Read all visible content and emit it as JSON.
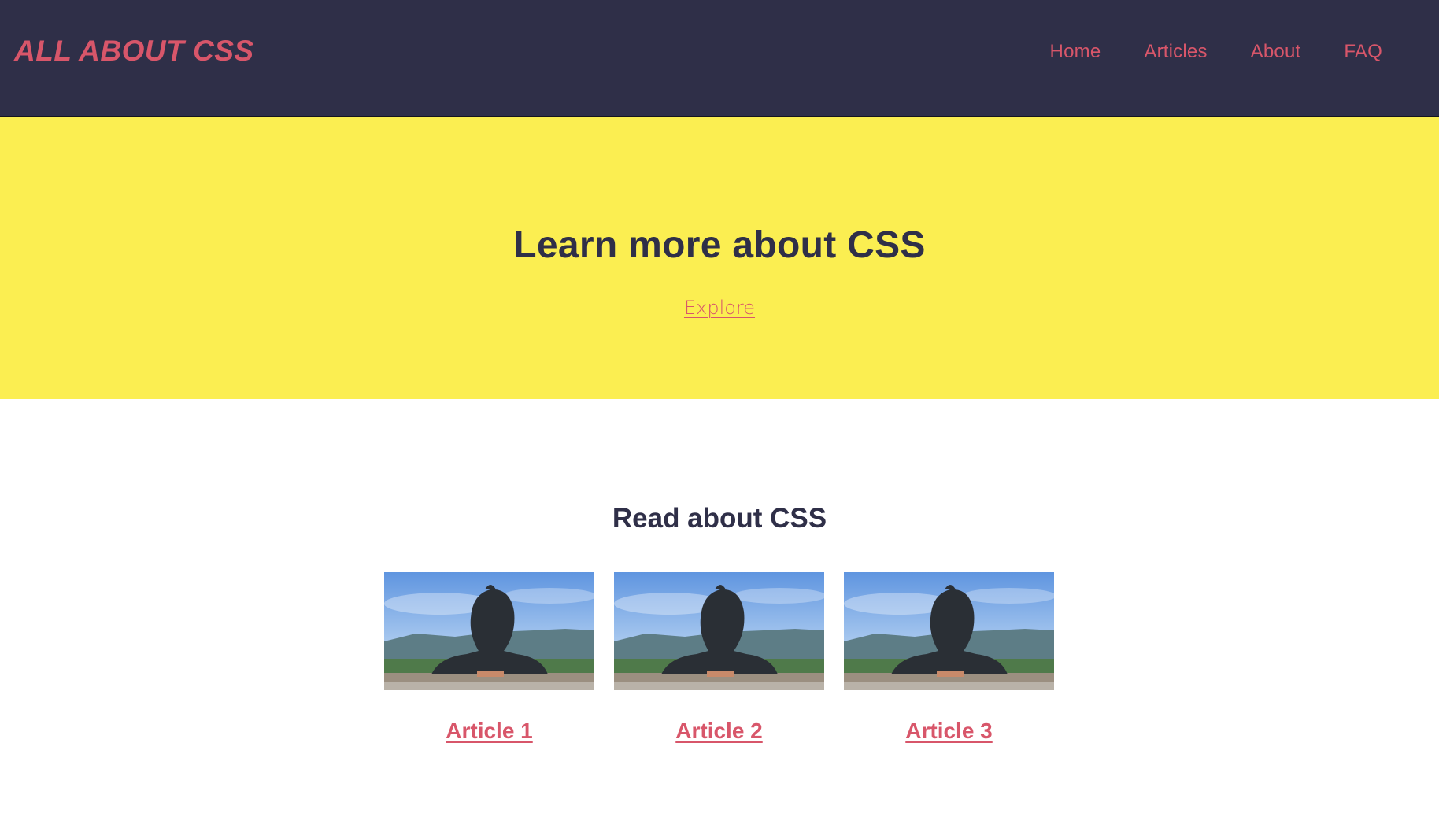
{
  "header": {
    "logo": "ALL ABOUT CSS",
    "nav": [
      {
        "label": "Home"
      },
      {
        "label": "Articles"
      },
      {
        "label": "About"
      },
      {
        "label": "FAQ"
      }
    ]
  },
  "hero": {
    "title": "Learn more about CSS",
    "link_label": "Explore"
  },
  "articles": {
    "heading": "Read about CSS",
    "items": [
      {
        "title": "Article 1",
        "image": "statue-photo"
      },
      {
        "title": "Article 2",
        "image": "statue-photo"
      },
      {
        "title": "Article 3",
        "image": "statue-photo"
      }
    ]
  },
  "colors": {
    "header_bg": "#2f2f48",
    "accent": "#d8566a",
    "hero_bg": "#fbee51",
    "text_dark": "#2f2f48"
  }
}
